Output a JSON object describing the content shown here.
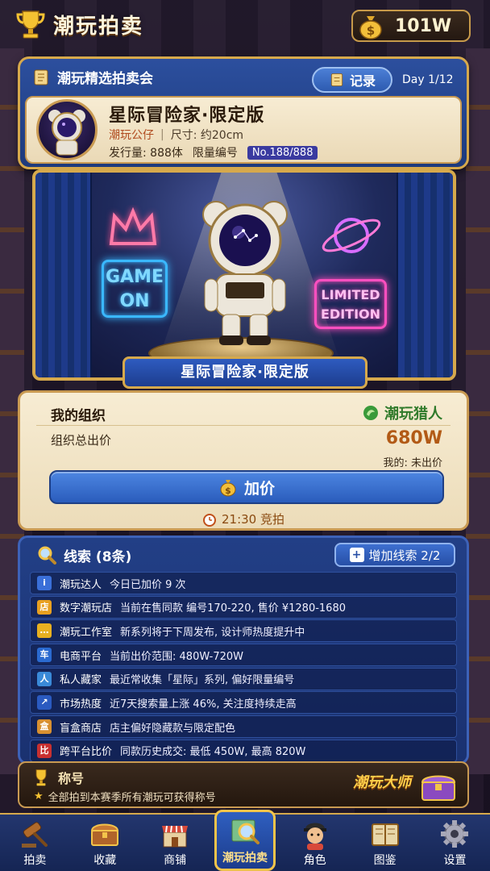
{
  "header": {
    "title": "潮玩拍卖",
    "currency": "101W"
  },
  "auction": {
    "title": "潮玩精选拍卖会",
    "record_label": "记录",
    "day": "Day 1/12",
    "product": {
      "name": "星际冒险家·限定版",
      "category": "潮玩公仔",
      "size": "尺寸: 约20cm",
      "issue": "发行量: 888体",
      "serial_label": "限量编号",
      "serial": "No.188/888"
    }
  },
  "stage": {
    "banner": "星际冒险家·限定版",
    "neon_left_line1": "GAME",
    "neon_left_line2": "ON",
    "neon_right_line1": "LIMITED",
    "neon_right_line2": "EDITION"
  },
  "bid": {
    "org_title": "我的组织",
    "org_tag": "潮玩猎人",
    "total_label": "组织总出价",
    "total_value": "680W",
    "my_bid": "我的: 未出价",
    "raise_label": "加价",
    "timer": "21:30 竞拍"
  },
  "clues": {
    "title": "线索 (8条)",
    "add_label": "增加线索 2/2",
    "items": [
      {
        "icon_color": "#3a6fd8",
        "glyph": "i",
        "source": "潮玩达人",
        "text": "今日已加价 9 次"
      },
      {
        "icon_color": "#e8a020",
        "glyph": "店",
        "source": "数字潮玩店",
        "text": "当前在售同款 编号170-220, 售价 ¥1280-1680"
      },
      {
        "icon_color": "#e8b020",
        "glyph": "…",
        "source": "潮玩工作室",
        "text": "新系列将于下周发布, 设计师热度提升中"
      },
      {
        "icon_color": "#2a6ad0",
        "glyph": "车",
        "source": "电商平台",
        "text": "当前出价范围: 480W-720W"
      },
      {
        "icon_color": "#3a8ad8",
        "glyph": "人",
        "source": "私人藏家",
        "text": "最近常收集「星际」系列, 偏好限量编号"
      },
      {
        "icon_color": "#2a5ac0",
        "glyph": "↗",
        "source": "市场热度",
        "text": "近7天搜索量上涨 46%, 关注度持续走高"
      },
      {
        "icon_color": "#d89030",
        "glyph": "盒",
        "source": "盲盒商店",
        "text": "店主偏好隐藏款与限定配色"
      },
      {
        "icon_color": "#c83030",
        "glyph": "比",
        "source": "跨平台比价",
        "text": "同款历史成交: 最低 450W, 最高 820W"
      }
    ]
  },
  "title_section": {
    "label": "称号",
    "desc": "全部拍到本赛季所有潮玩可获得称号",
    "award": "潮玩大师"
  },
  "nav": [
    {
      "label": "拍卖",
      "icon": "gavel-icon"
    },
    {
      "label": "收藏",
      "icon": "treasure-chest-icon"
    },
    {
      "label": "商铺",
      "icon": "shop-icon"
    },
    {
      "label": "潮玩拍卖",
      "icon": "magnifier-map-icon",
      "active": true
    },
    {
      "label": "角色",
      "icon": "character-icon"
    },
    {
      "label": "图鉴",
      "icon": "book-icon"
    },
    {
      "label": "设置",
      "icon": "gear-icon"
    }
  ]
}
